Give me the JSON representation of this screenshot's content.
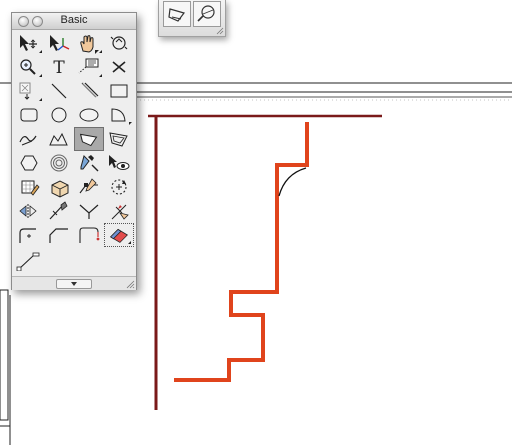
{
  "palette": {
    "title": "Basic",
    "tools": [
      {
        "name": "selection-tool-icon",
        "kind": "selection"
      },
      {
        "name": "3d-selection-tool-icon",
        "kind": "selection3d"
      },
      {
        "name": "pan-hand-icon",
        "kind": "pan"
      },
      {
        "name": "flyover-icon",
        "kind": "flyover"
      },
      {
        "name": "zoom-icon",
        "kind": "zoom"
      },
      {
        "name": "text-tool-icon",
        "kind": "text"
      },
      {
        "name": "callout-tool-icon",
        "kind": "callout"
      },
      {
        "name": "locus-tool-icon",
        "kind": "locus"
      },
      {
        "name": "snap-loupe-icon",
        "kind": "loupe"
      },
      {
        "name": "line-tool-icon",
        "kind": "line"
      },
      {
        "name": "double-line-tool-icon",
        "kind": "doubleline"
      },
      {
        "name": "rectangle-tool-icon",
        "kind": "rectangle"
      },
      {
        "name": "rounded-rectangle-tool-icon",
        "kind": "roundrect"
      },
      {
        "name": "circle-tool-icon",
        "kind": "circle"
      },
      {
        "name": "oval-tool-icon",
        "kind": "oval"
      },
      {
        "name": "arc-tool-icon",
        "kind": "arc"
      },
      {
        "name": "freehand-tool-icon",
        "kind": "freehand"
      },
      {
        "name": "polyline-tool-icon",
        "kind": "polyline"
      },
      {
        "name": "polygon-tool-icon",
        "kind": "polygon",
        "selected": true
      },
      {
        "name": "double-line-polygon-tool-icon",
        "kind": "dlpolygon"
      },
      {
        "name": "regular-polygon-tool-icon",
        "kind": "hexagon"
      },
      {
        "name": "spiral-tool-icon",
        "kind": "spiral"
      },
      {
        "name": "eyedropper-tool-icon",
        "kind": "eyedropper"
      },
      {
        "name": "visibility-tool-icon",
        "kind": "visibility"
      },
      {
        "name": "attribute-mapping-tool-icon",
        "kind": "attrmap"
      },
      {
        "name": "clip-cube-tool-icon",
        "kind": "clipcube"
      },
      {
        "name": "reshape-tool-icon",
        "kind": "reshape"
      },
      {
        "name": "rotate-tool-icon",
        "kind": "rotate"
      },
      {
        "name": "mirror-tool-icon",
        "kind": "mirror"
      },
      {
        "name": "split-tool-icon",
        "kind": "split"
      },
      {
        "name": "connect-combine-tool-icon",
        "kind": "connect"
      },
      {
        "name": "trim-tool-icon",
        "kind": "trim"
      },
      {
        "name": "fillet-tool-icon",
        "kind": "fillet"
      },
      {
        "name": "chamfer-tool-icon",
        "kind": "chamfer"
      },
      {
        "name": "clip-tool-icon",
        "kind": "clip"
      },
      {
        "name": "eraser-tool-icon",
        "kind": "eraser",
        "pressed": true
      },
      {
        "name": "offset-tool-icon",
        "kind": "offset"
      }
    ]
  },
  "drawing": {
    "profile_color": "#e0441c",
    "frame_color": "#7a1a1a",
    "arc_color": "#111111"
  }
}
